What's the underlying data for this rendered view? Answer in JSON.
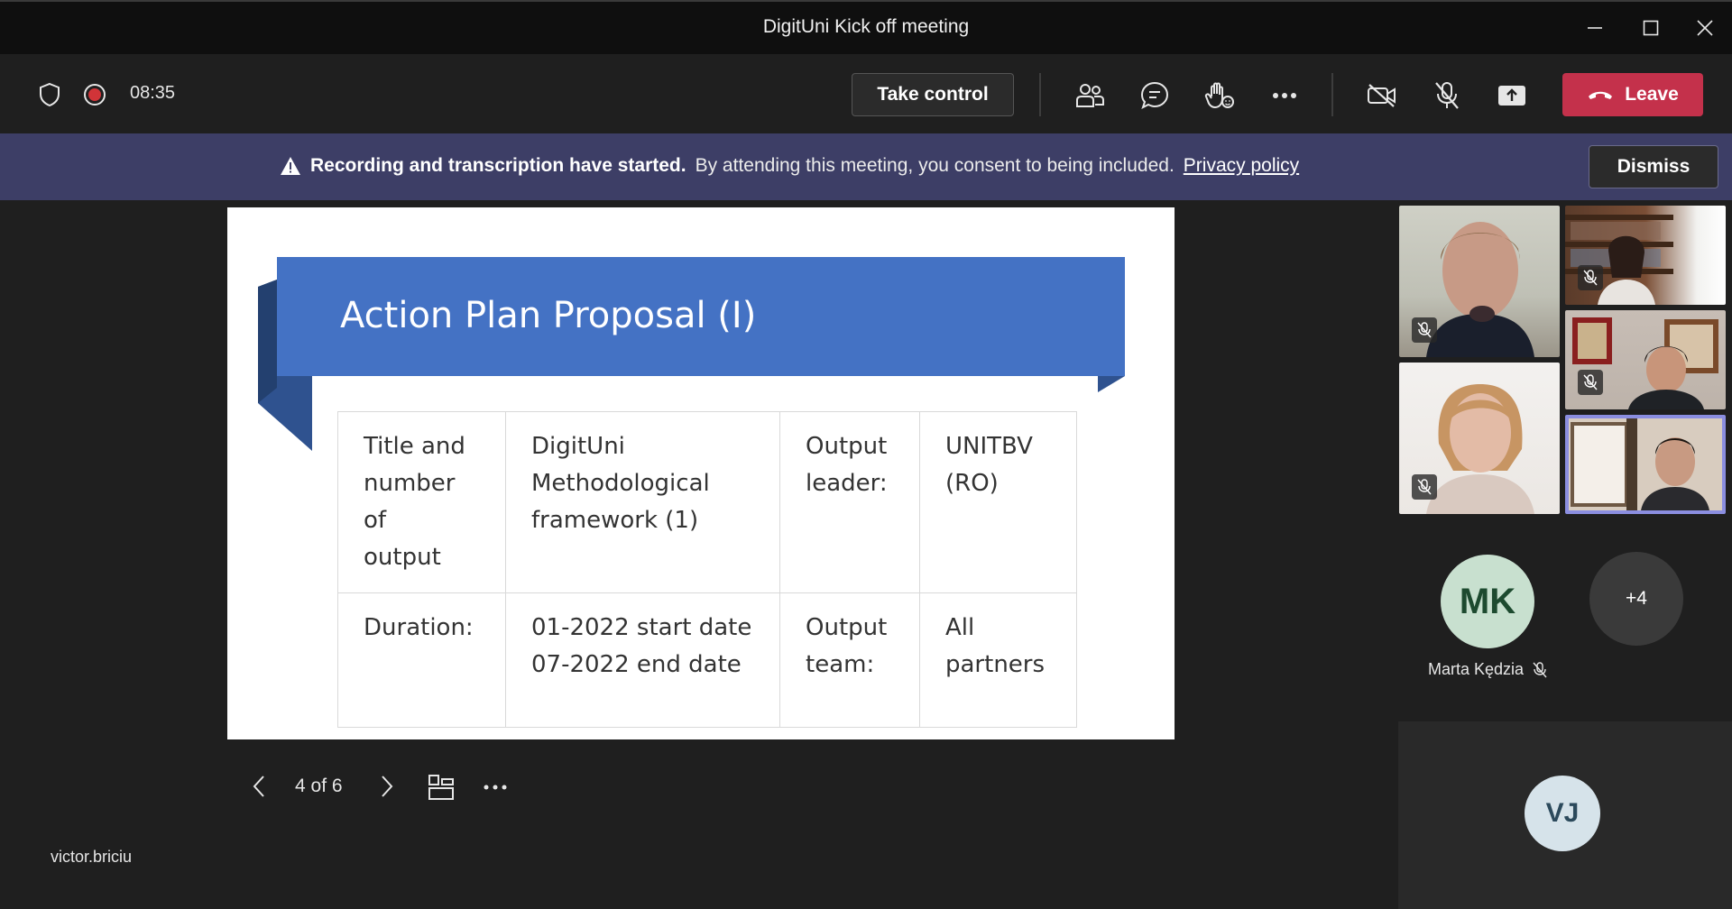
{
  "window": {
    "title": "DigitUni Kick off meeting"
  },
  "toolbar": {
    "timer": "08:35",
    "take_control_label": "Take control",
    "leave_label": "Leave"
  },
  "banner": {
    "bold_text": "Recording and transcription have started.",
    "text": "By attending this meeting, you consent to being included.",
    "link": "Privacy policy",
    "dismiss_label": "Dismiss"
  },
  "slide": {
    "title": "Action Plan Proposal (I)",
    "table": {
      "rows": [
        {
          "c1": [
            "Title and",
            "number of",
            "output"
          ],
          "c2": [
            "DigitUni",
            "Methodological",
            "framework (1)"
          ],
          "c3": [
            "Output",
            "leader:"
          ],
          "c4": [
            "UNITBV",
            "(RO)"
          ]
        },
        {
          "c1": [
            "Duration:"
          ],
          "c2": [
            "01-2022 start date",
            "07-2022 end date"
          ],
          "c3": [
            "Output",
            "team:"
          ],
          "c4": [
            "All",
            "partners"
          ]
        }
      ]
    }
  },
  "slide_nav": {
    "counter": "4 of 6"
  },
  "presenter_name": "victor.briciu",
  "participants": {
    "mk_initials": "MK",
    "mk_name": "Marta Kędzia",
    "more_count": "+4",
    "vj_initials": "VJ"
  },
  "colors": {
    "leave": "#c4314b",
    "banner": "#3d3e66",
    "ribbon": "#4472c4",
    "active_speaker_border": "#8b8ee0"
  }
}
